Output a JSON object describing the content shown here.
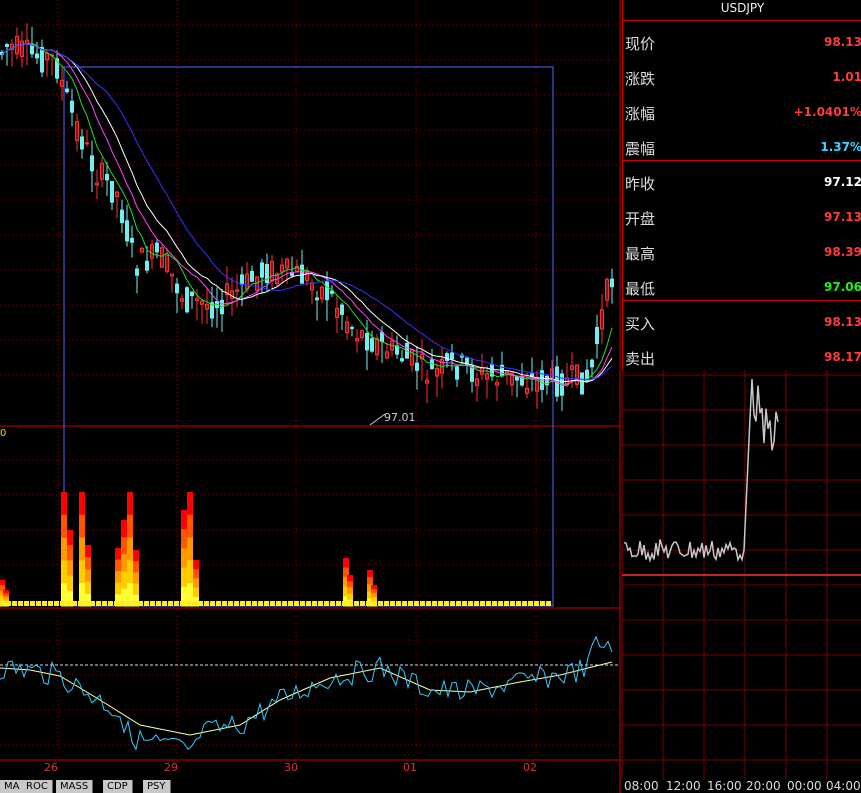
{
  "instrument": "USDJPY",
  "quote": [
    {
      "label": "现价",
      "value": "98.13",
      "color": "#ff3b3b"
    },
    {
      "label": "涨跌",
      "value": "1.01",
      "color": "#ff3b3b"
    },
    {
      "label": "涨幅",
      "value": "+1.0401%",
      "color": "#ff3b3b"
    },
    {
      "label": "震幅",
      "value": "1.37%",
      "color": "#3ad6ff"
    },
    {
      "label": "昨收",
      "value": "97.12",
      "color": "#ffffff"
    },
    {
      "label": "开盘",
      "value": "97.13",
      "color": "#ff3b3b"
    },
    {
      "label": "最高",
      "value": "98.39",
      "color": "#ff3b3b"
    },
    {
      "label": "最低",
      "value": "97.06",
      "color": "#22ee22"
    },
    {
      "label": "买入",
      "value": "98.13",
      "color": "#ff3b3b"
    },
    {
      "label": "卖出",
      "value": "98.17",
      "color": "#ff3b3b"
    }
  ],
  "main_chart": {
    "low_marker": "97.01",
    "volume_axis_label": "0"
  },
  "x_axis_dates": [
    "26",
    "29",
    "30",
    "01",
    "02"
  ],
  "indicator_tabs": [
    "MA",
    "ROC",
    "MASS",
    "CDP",
    "PSY"
  ],
  "intraday_times": [
    "08:00",
    "12:00",
    "16:00",
    "20:00",
    "00:00",
    "04:00"
  ],
  "colors": {
    "grid": "#7a0000",
    "up_candle": "#ff3030",
    "down_candle": "#6ef0f0",
    "ma_fast": "#ffffff",
    "ma_mid": "#ff44ff",
    "ma_slow": "#3333ff",
    "ma_green": "#22dd22",
    "selection_box": "#5566ff",
    "intraday_line": "#c8c8c8"
  }
}
